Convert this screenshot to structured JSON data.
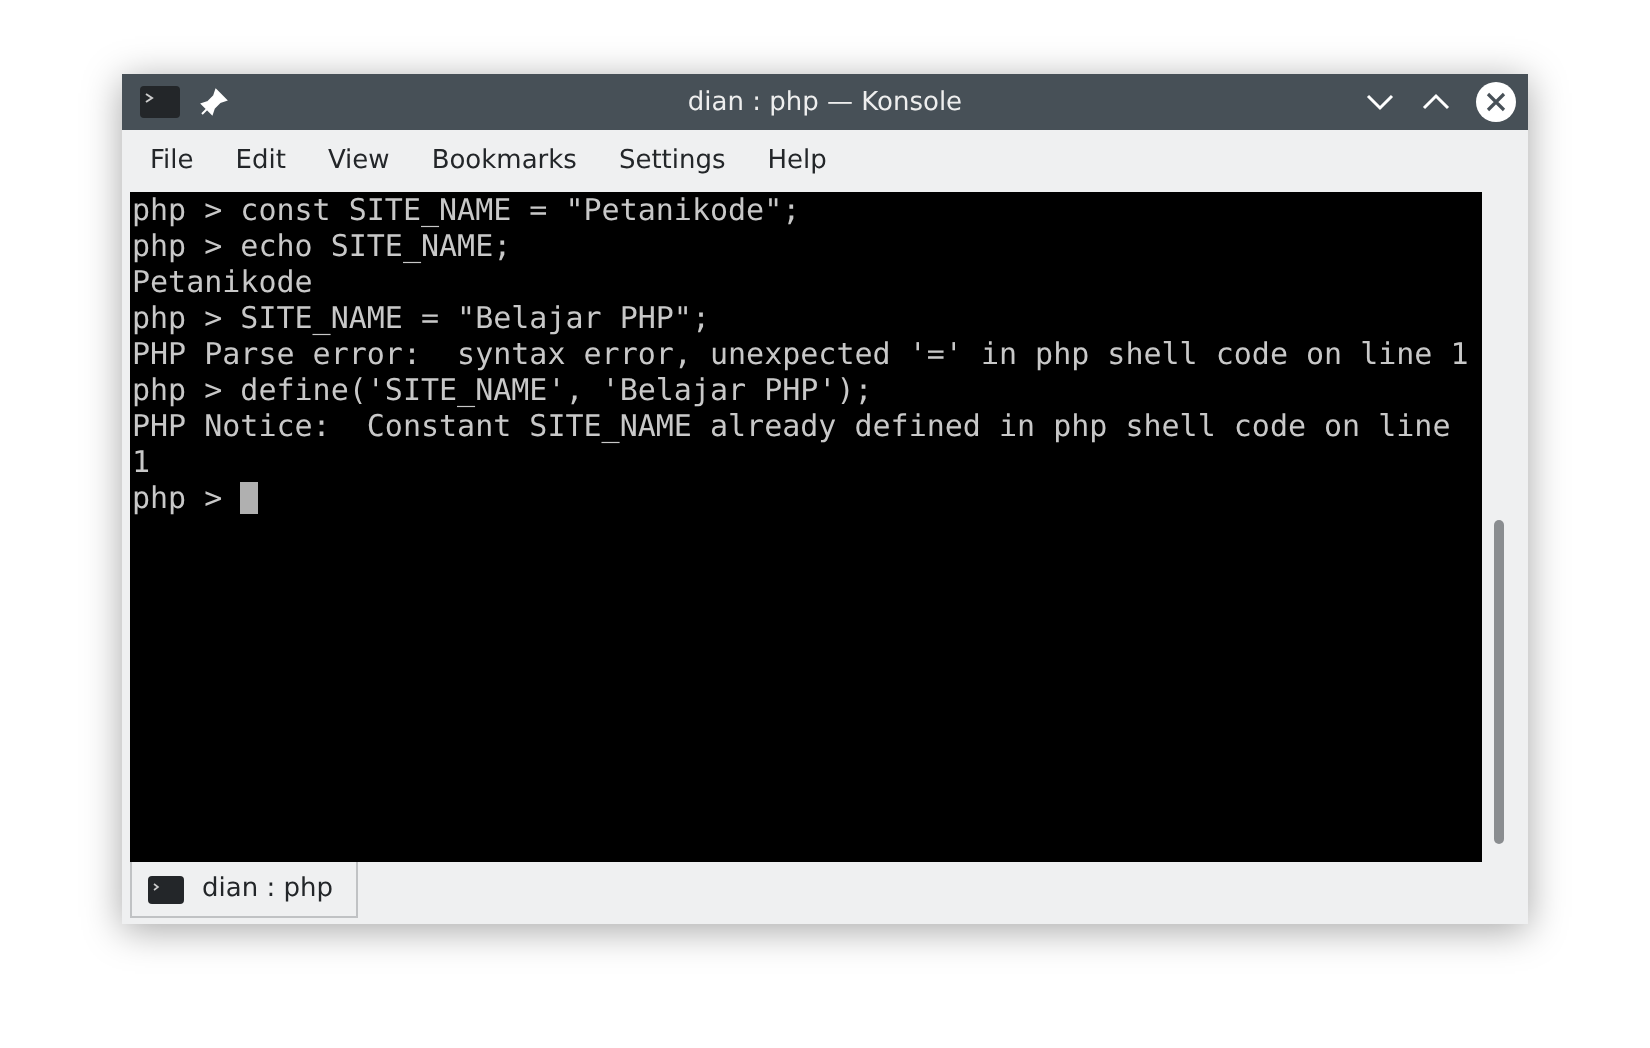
{
  "window": {
    "title": "dian : php — Konsole"
  },
  "menu": [
    "File",
    "Edit",
    "View",
    "Bookmarks",
    "Settings",
    "Help"
  ],
  "terminal": {
    "lines": [
      "php > const SITE_NAME = \"Petanikode\";",
      "php > echo SITE_NAME;",
      "Petanikode",
      "php > SITE_NAME = \"Belajar PHP\";",
      "PHP Parse error:  syntax error, unexpected '=' in php shell code on line 1",
      "php > define('SITE_NAME', 'Belajar PHP');",
      "PHP Notice:  Constant SITE_NAME already defined in php shell code on line",
      "1"
    ],
    "prompt": "php >"
  },
  "tabs": [
    {
      "label": "dian : php",
      "selected": true
    }
  ]
}
